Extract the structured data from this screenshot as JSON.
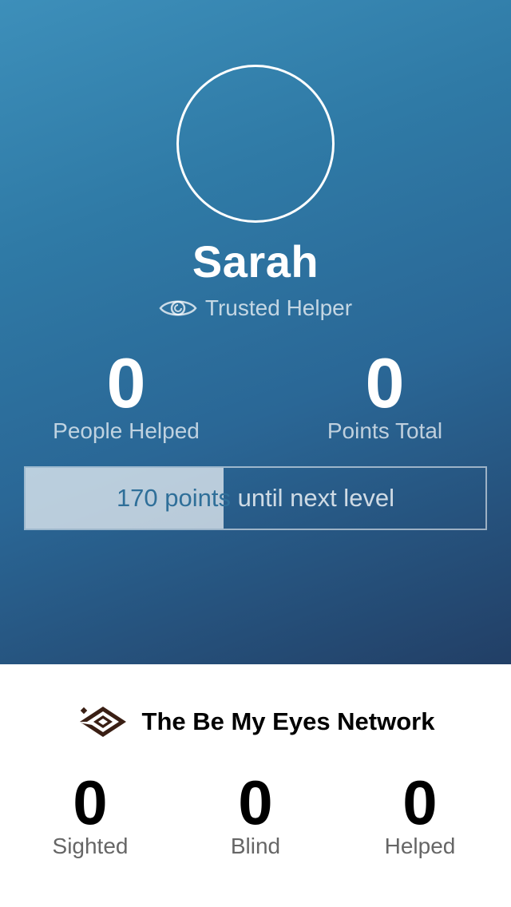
{
  "profile": {
    "name": "Sarah",
    "role": "Trusted Helper",
    "role_icon": "eye-icon",
    "stats": {
      "people_helped": {
        "value": "0",
        "label": "People Helped"
      },
      "points_total": {
        "value": "0",
        "label": "Points Total"
      }
    },
    "progress": {
      "text_part1": "170 points",
      "text_part2": " until next level",
      "fraction": 0.43
    }
  },
  "network": {
    "logo_icon": "be-my-eyes-logo",
    "title": "The Be My Eyes Network",
    "stats": {
      "sighted": {
        "value": "0",
        "label": "Sighted"
      },
      "blind": {
        "value": "0",
        "label": "Blind"
      },
      "helped": {
        "value": "0",
        "label": "Helped"
      }
    }
  },
  "colors": {
    "gradient_top": "#3d8fba",
    "gradient_bottom": "#223f66",
    "progress_text": "#2f6f99"
  }
}
